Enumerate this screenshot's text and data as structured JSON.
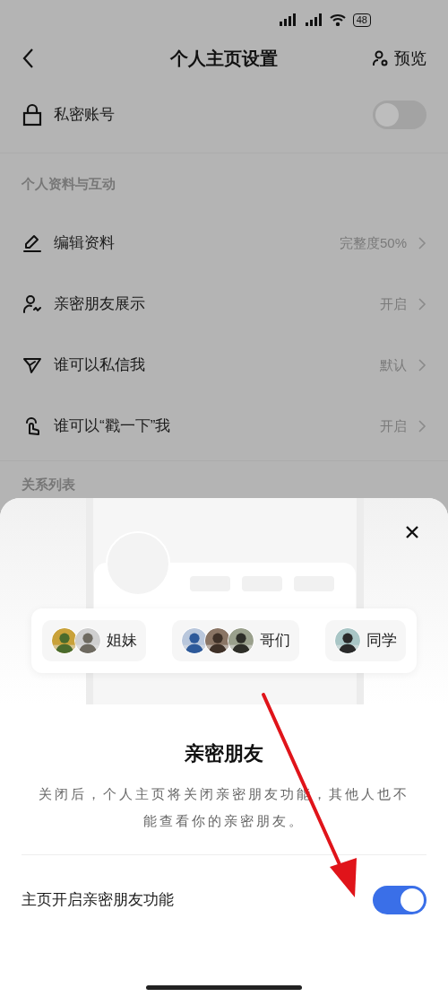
{
  "status_bar": {
    "battery": "48"
  },
  "header": {
    "title": "个人主页设置",
    "action": "预览"
  },
  "private_account": {
    "label": "私密账号",
    "on": false
  },
  "profile_section": {
    "heading": "个人资料与互动",
    "items": [
      {
        "kind": "edit",
        "label": "编辑资料",
        "value": "完整度50%"
      },
      {
        "kind": "friends",
        "label": "亲密朋友展示",
        "value": "开启"
      },
      {
        "kind": "send",
        "label": "谁可以私信我",
        "value": "默认"
      },
      {
        "kind": "tap",
        "label": "谁可以“戳一下”我",
        "value": "开启"
      }
    ]
  },
  "relation_section": {
    "heading": "关系列表"
  },
  "sheet": {
    "groups": [
      {
        "label": "姐妹"
      },
      {
        "label": "哥们"
      },
      {
        "label": "同学"
      }
    ],
    "title": "亲密朋友",
    "description": "关闭后，个人主页将关闭亲密朋友功能，其他人也不能查看你的亲密朋友。",
    "toggle": {
      "label": "主页开启亲密朋友功能",
      "on": true
    }
  }
}
